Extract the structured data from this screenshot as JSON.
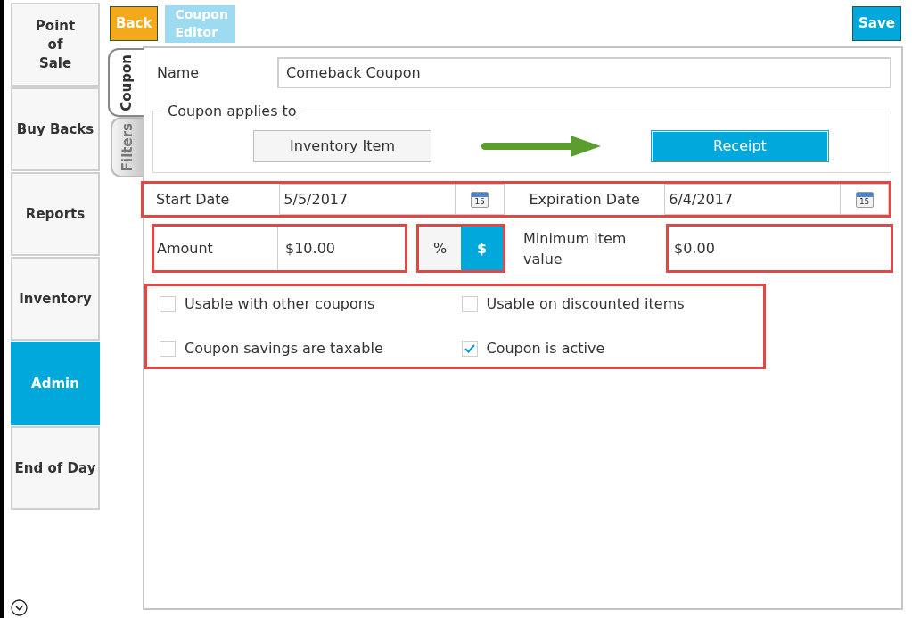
{
  "sidebar": {
    "items": [
      {
        "label": "Point\nof\nSale",
        "selected": false
      },
      {
        "label": "Buy Backs",
        "selected": false
      },
      {
        "label": "Reports",
        "selected": false
      },
      {
        "label": "Inventory",
        "selected": false
      },
      {
        "label": "Admin",
        "selected": true
      },
      {
        "label": "End of Day",
        "selected": false
      }
    ]
  },
  "toolbar": {
    "back": "Back",
    "title": "Coupon\nEditor",
    "save": "Save"
  },
  "tabs": [
    {
      "label": "Coupon",
      "selected": true
    },
    {
      "label": "Filters",
      "selected": false
    }
  ],
  "name": {
    "label": "Name",
    "value": "Comeback Coupon"
  },
  "applies_to": {
    "legend": "Coupon applies to",
    "options": [
      {
        "label": "Inventory Item",
        "selected": false
      },
      {
        "label": "Receipt",
        "selected": true
      }
    ]
  },
  "dates": {
    "highlighted": true,
    "start_label": "Start Date",
    "start_value": "5/5/2017",
    "start_calendar_day": "15",
    "end_calendar_day": "15",
    "end_label": "Expiration Date",
    "end_value": "6/4/2017"
  },
  "amount": {
    "highlighted": true,
    "label": "Amount",
    "value": "$10.00"
  },
  "amount_type": {
    "highlighted": true,
    "options": [
      {
        "label": "%",
        "selected": false
      },
      {
        "label": "$",
        "selected": true
      }
    ]
  },
  "minimum": {
    "highlighted": true,
    "label": "Minimum item value",
    "value": "$0.00"
  },
  "options": {
    "highlighted": true,
    "items": [
      {
        "label": "Usable with other coupons",
        "checked": false
      },
      {
        "label": "Usable on discounted items",
        "checked": false
      },
      {
        "label": "Coupon savings are taxable",
        "checked": false
      },
      {
        "label": "Coupon is active",
        "checked": true
      }
    ]
  }
}
